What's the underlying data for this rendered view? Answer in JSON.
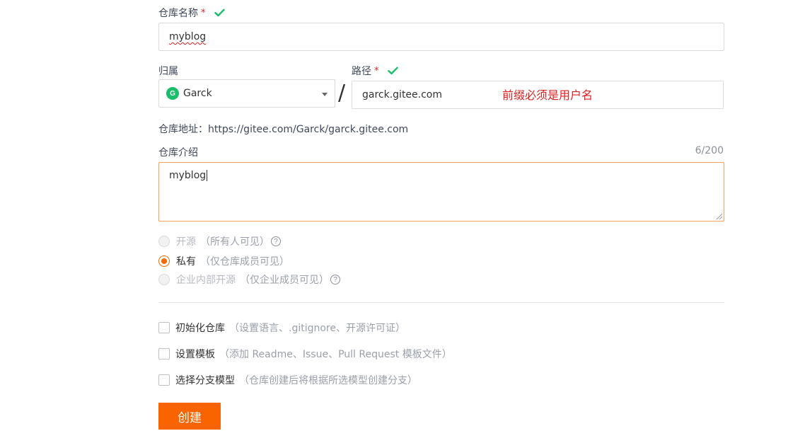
{
  "repo_name": {
    "label": "仓库名称",
    "required_mark": "*",
    "value": "myblog"
  },
  "owner": {
    "label": "归属",
    "avatar_letter": "G",
    "value": "Garck"
  },
  "separator": "/",
  "path": {
    "label": "路径",
    "required_mark": "*",
    "value": "garck.gitee.com",
    "note": "前缀必须是用户名"
  },
  "repo_address": {
    "label": "仓库地址：",
    "value": "https://gitee.com/Garck/garck.gitee.com"
  },
  "description": {
    "label": "仓库介绍",
    "counter": "6/200",
    "value": "myblog"
  },
  "visibility": [
    {
      "label": "开源",
      "hint": "（所有人可见）",
      "selected": false,
      "disabled": true,
      "help": "?"
    },
    {
      "label": "私有",
      "hint": "（仅仓库成员可见）",
      "selected": true,
      "disabled": false
    },
    {
      "label": "企业内部开源",
      "hint": "（仅企业成员可见）",
      "selected": false,
      "disabled": true,
      "help": "?"
    }
  ],
  "options": [
    {
      "label": "初始化仓库",
      "hint": "（设置语言、.gitignore、开源许可证）",
      "checked": false
    },
    {
      "label": "设置模板",
      "hint": "（添加 Readme、Issue、Pull Request 模板文件）",
      "checked": false
    },
    {
      "label": "选择分支模型",
      "hint": "（仓库创建后将根据所选模型创建分支）",
      "checked": false
    }
  ],
  "create_button": "创建",
  "colors": {
    "accent": "#fa6400",
    "valid": "#19be6b",
    "error": "#e02020"
  },
  "icons": {
    "valid": "check-icon",
    "help": "question-circle-icon",
    "dropdown": "caret-down-icon"
  }
}
